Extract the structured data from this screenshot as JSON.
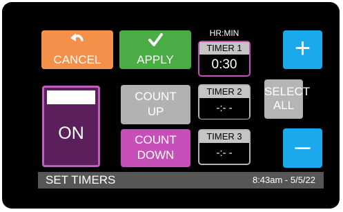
{
  "buttons": {
    "cancel": {
      "label": "CANCEL",
      "icon": "undo-arrow-icon",
      "color": "#f3914a"
    },
    "apply": {
      "label": "APPLY",
      "icon": "checkmark-icon",
      "color": "#4aac45"
    },
    "plus": {
      "symbol": "+",
      "color": "#1aa9ec"
    },
    "minus": {
      "symbol": "–",
      "color": "#1aa9ec"
    },
    "select_all": {
      "line1": "SELECT",
      "line2": "ALL"
    },
    "count_up": {
      "line1": "COUNT",
      "line2": "UP"
    },
    "count_down": {
      "line1": "COUNT",
      "line2": "DOWN",
      "color": "#c64fba"
    }
  },
  "on_off": {
    "state": "ON"
  },
  "timers": {
    "unit_label": "HR:MIN",
    "items": [
      {
        "name": "TIMER 1",
        "value": "0:30",
        "active": true
      },
      {
        "name": "TIMER 2",
        "value": "-:- -",
        "active": false
      },
      {
        "name": "TIMER 3",
        "value": "-:- -",
        "active": false
      }
    ]
  },
  "status": {
    "title": "SET TIMERS",
    "datetime": "8:43am - 5/5/22"
  }
}
